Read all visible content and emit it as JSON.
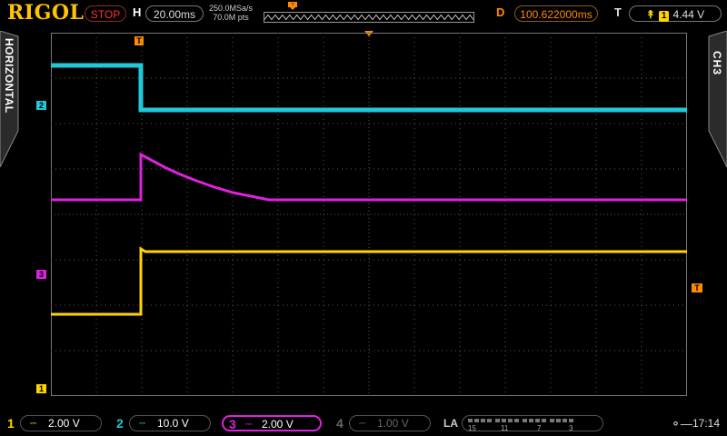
{
  "brand": "RIGOL",
  "run_state": "STOP",
  "horizontal": {
    "label": "H",
    "timebase": "20.00ms",
    "sample_rate": "250.0MSa/s",
    "memory_depth": "70.0M pts"
  },
  "delay": {
    "label": "D",
    "value": "100.622000ms"
  },
  "trigger": {
    "label": "T",
    "source": "1",
    "level": "4.44 V",
    "marker": "T"
  },
  "left_tab": "HORIZONTAL",
  "right_tab": "CH3",
  "markers": {
    "ch1": "1",
    "ch2": "2",
    "ch3": "3"
  },
  "channels": [
    {
      "num": "1",
      "scale": "2.00 V",
      "color": "#ffd400"
    },
    {
      "num": "2",
      "scale": "10.0 V",
      "color": "#20c8d8"
    },
    {
      "num": "3",
      "scale": "2.00 V",
      "color": "#e020e0"
    },
    {
      "num": "4",
      "scale": "1.00 V",
      "color": "#666666"
    }
  ],
  "la": {
    "label": "LA",
    "numbers": [
      "15",
      "11",
      "7",
      "3"
    ]
  },
  "clock": "17:14",
  "colors": {
    "grid": "#5a5a5a",
    "ch1": "#ffd400",
    "ch2": "#20c8d8",
    "ch3": "#e020e0",
    "trigger": "#ff8c00"
  }
}
